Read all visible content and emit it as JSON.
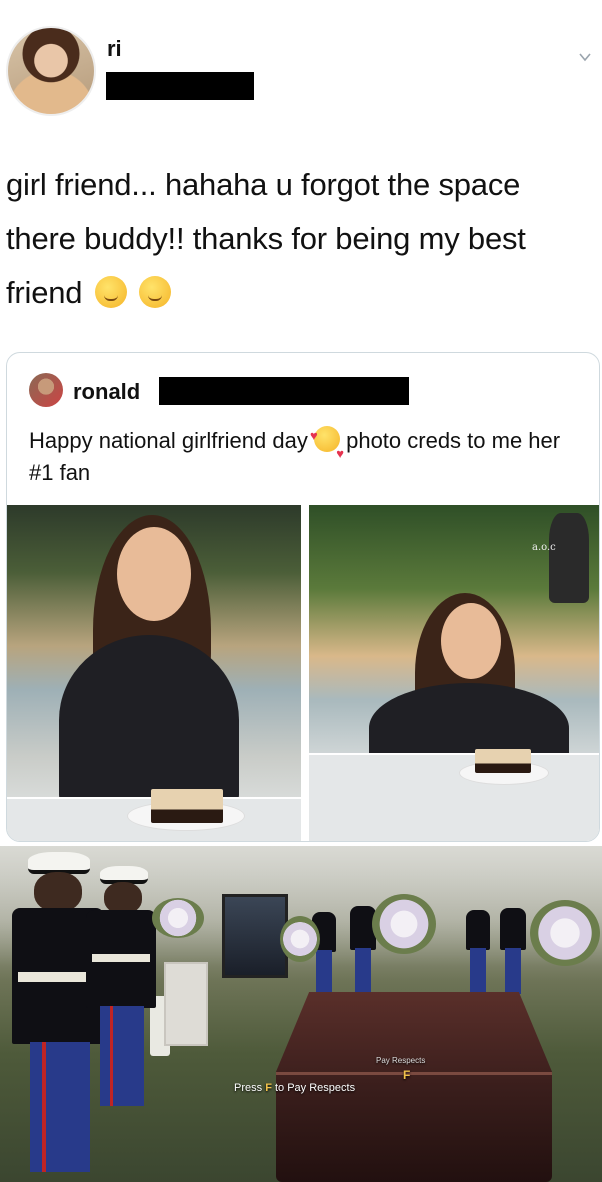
{
  "tweet": {
    "author_name": "ri",
    "text": "girl friend... hahaha u forgot the space there buddy!! thanks for being my best friend",
    "emojis": [
      "kissing-face-emoji",
      "relieved-face-emoji"
    ]
  },
  "quoted_tweet": {
    "author_name": "ronald",
    "text_before_emoji": "Happy national girlfriend day",
    "text_after_emoji": "photo creds to me her #1 fan",
    "emoji": "smiling-face-with-hearts-emoji",
    "bottle_label": "a.o.c"
  },
  "meme": {
    "hint_prefix": "Press",
    "hint_key": "F",
    "hint_suffix": "to Pay Respects",
    "prompt_label": "Pay Respects",
    "prompt_key": "F"
  }
}
